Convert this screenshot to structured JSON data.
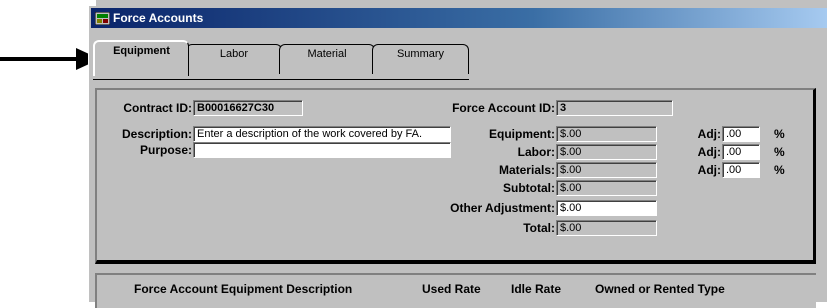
{
  "window": {
    "title": "Force Accounts"
  },
  "tabs": [
    {
      "label": "Equipment",
      "active": true
    },
    {
      "label": "Labor",
      "active": false
    },
    {
      "label": "Material",
      "active": false
    },
    {
      "label": "Summary",
      "active": false
    }
  ],
  "form": {
    "contract_id_label": "Contract ID:",
    "contract_id_value": "B00016627C30",
    "force_account_id_label": "Force Account ID:",
    "force_account_id_value": "3",
    "description_label": "Description:",
    "description_value": "Enter a description of the work covered by FA.",
    "purpose_label": "Purpose:",
    "purpose_value": "",
    "equipment_label": "Equipment:",
    "equipment_value": "$.00",
    "labor_label": "Labor:",
    "labor_value": "$.00",
    "materials_label": "Materials:",
    "materials_value": "$.00",
    "subtotal_label": "Subtotal:",
    "subtotal_value": "$.00",
    "other_adjustment_label": "Other Adjustment:",
    "other_adjustment_value": "$.00",
    "total_label": "Total:",
    "total_value": "$.00",
    "adj_label": "Adj:",
    "adj_equipment_value": ".00",
    "adj_labor_value": ".00",
    "adj_materials_value": ".00",
    "percent_symbol": "%"
  },
  "table": {
    "columns": [
      "Force Account Equipment Description",
      "Used Rate",
      "Idle Rate",
      "Owned or Rented Type"
    ]
  },
  "colors": {
    "titlebar_start": "#0a246a",
    "titlebar_end": "#a6caf0",
    "window_bg": "#c0c0c0"
  }
}
